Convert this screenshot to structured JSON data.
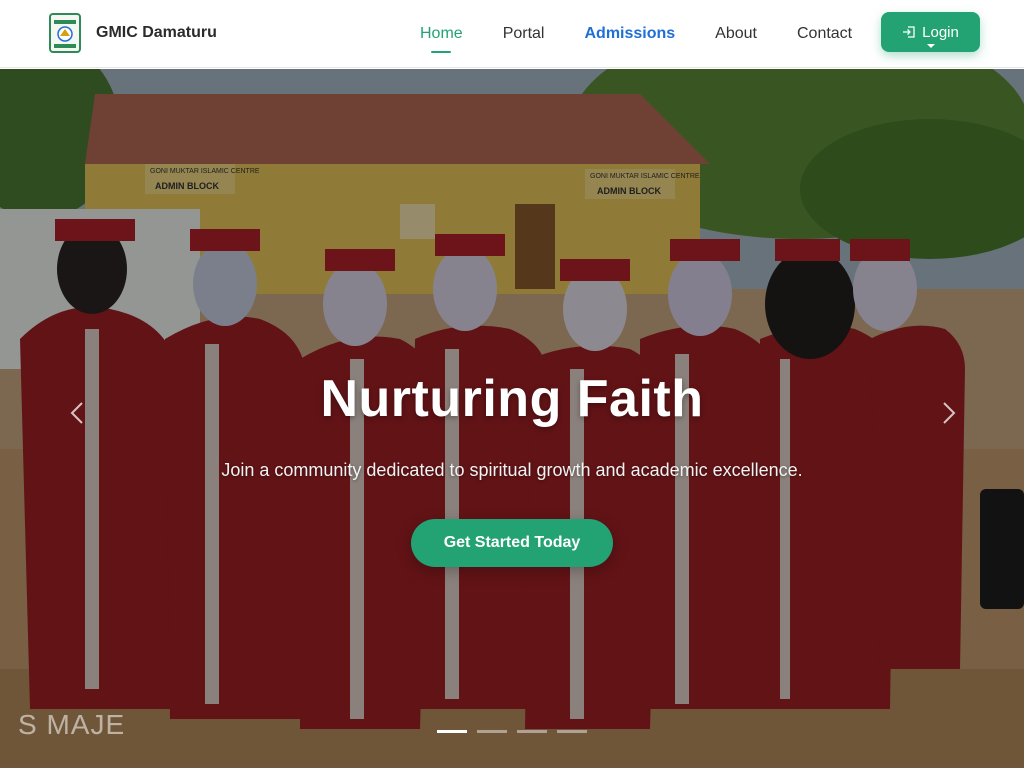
{
  "brand": {
    "name": "GMIC Damaturu",
    "logo_icon": "school-crest-icon"
  },
  "nav": {
    "items": [
      {
        "label": "Home",
        "state": "active"
      },
      {
        "label": "Portal",
        "state": "normal"
      },
      {
        "label": "Admissions",
        "state": "highlight"
      },
      {
        "label": "About",
        "state": "normal"
      },
      {
        "label": "Contact",
        "state": "normal"
      }
    ],
    "login_label": "Login",
    "login_icon": "login-icon"
  },
  "hero": {
    "title": "Nurturing Faith",
    "subtitle": "Join a community dedicated to spiritual growth and academic excellence.",
    "cta_label": "Get Started Today",
    "watermark": "S MAJE",
    "slides_total": 4,
    "active_slide": 1,
    "sign_left_lines": [
      "GONI MUKTAR ISLAMIC CENTRE",
      "ADMIN BLOCK"
    ],
    "sign_right_lines": [
      "GONI MUKTAR ISLAMIC CENTRE",
      "ADMIN BLOCK"
    ]
  },
  "colors": {
    "accent": "#23a373",
    "highlight": "#1f6fd6",
    "gown": "#9e1f24"
  }
}
